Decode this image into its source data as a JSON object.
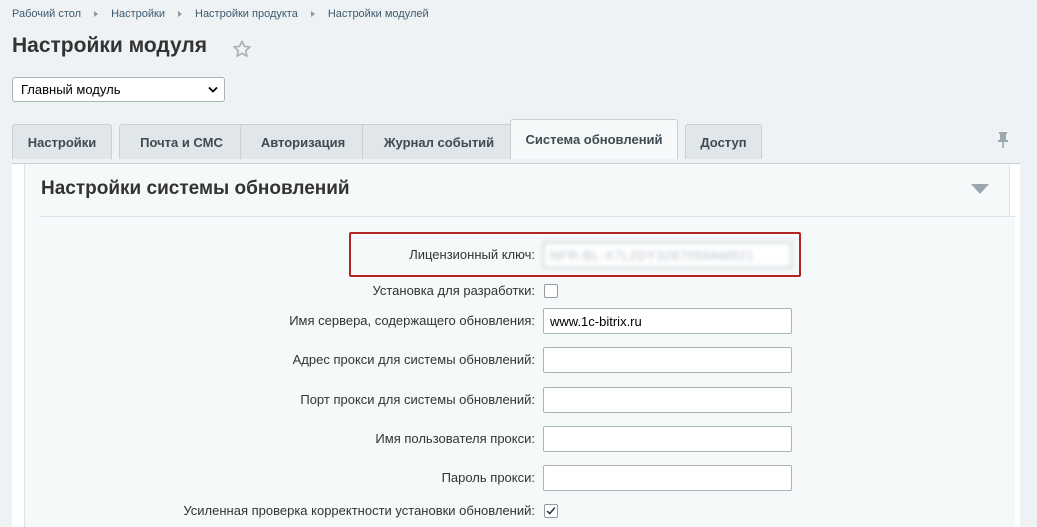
{
  "breadcrumb": [
    "Рабочий стол",
    "Настройки",
    "Настройки продукта",
    "Настройки модулей"
  ],
  "page_title": "Настройки модуля",
  "module_select": {
    "value": "Главный модуль"
  },
  "tabs": [
    {
      "label": "Настройки"
    },
    {
      "label": "Почта и СМС"
    },
    {
      "label": "Авторизация"
    },
    {
      "label": "Журнал событий"
    },
    {
      "label": "Система обновлений",
      "active": true
    },
    {
      "label": "Доступ"
    }
  ],
  "section": {
    "title": "Настройки системы обновлений",
    "fields": [
      {
        "label": "Лицензионный ключ:",
        "type": "text",
        "value": "NFR-BL-X7L2DY3287059AM921"
      },
      {
        "label": "Установка для разработки:",
        "type": "checkbox",
        "checked": false
      },
      {
        "label": "Имя сервера, содержащего обновления:",
        "type": "text",
        "value": "www.1c-bitrix.ru"
      },
      {
        "label": "Адрес прокси для системы обновлений:",
        "type": "text",
        "value": ""
      },
      {
        "label": "Порт прокси для системы обновлений:",
        "type": "text",
        "value": ""
      },
      {
        "label": "Имя пользователя прокси:",
        "type": "text",
        "value": ""
      },
      {
        "label": "Пароль прокси:",
        "type": "text",
        "value": ""
      },
      {
        "label": "Усиленная проверка корректности установки обновлений:",
        "type": "checkbox",
        "checked": true
      }
    ]
  },
  "colors": {
    "highlight": "#b02424",
    "background": "#eef2f4"
  }
}
